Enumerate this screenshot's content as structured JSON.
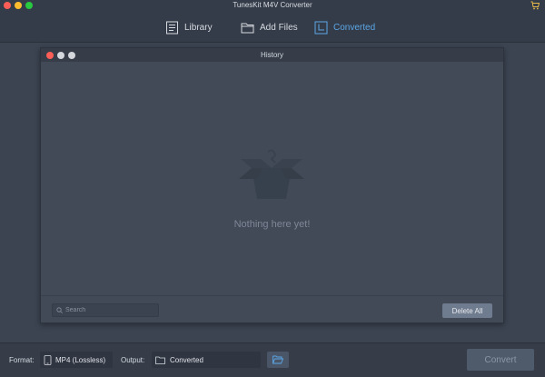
{
  "app": {
    "title": "TunesKit M4V Converter"
  },
  "toolbar": {
    "tabs": [
      {
        "label": "Library",
        "icon": "library-icon"
      },
      {
        "label": "Add Files",
        "icon": "folder-icon"
      },
      {
        "label": "Converted",
        "icon": "clock-icon",
        "active": true
      }
    ],
    "active_color": "#5aa7e6"
  },
  "history": {
    "title": "History",
    "empty_message": "Nothing here yet!",
    "search_placeholder": "Search",
    "delete_all_label": "Delete All"
  },
  "bottom": {
    "format_label": "Format:",
    "format_value": "MP4 (Lossless)",
    "output_label": "Output:",
    "output_value": "Converted",
    "convert_label": "Convert"
  }
}
